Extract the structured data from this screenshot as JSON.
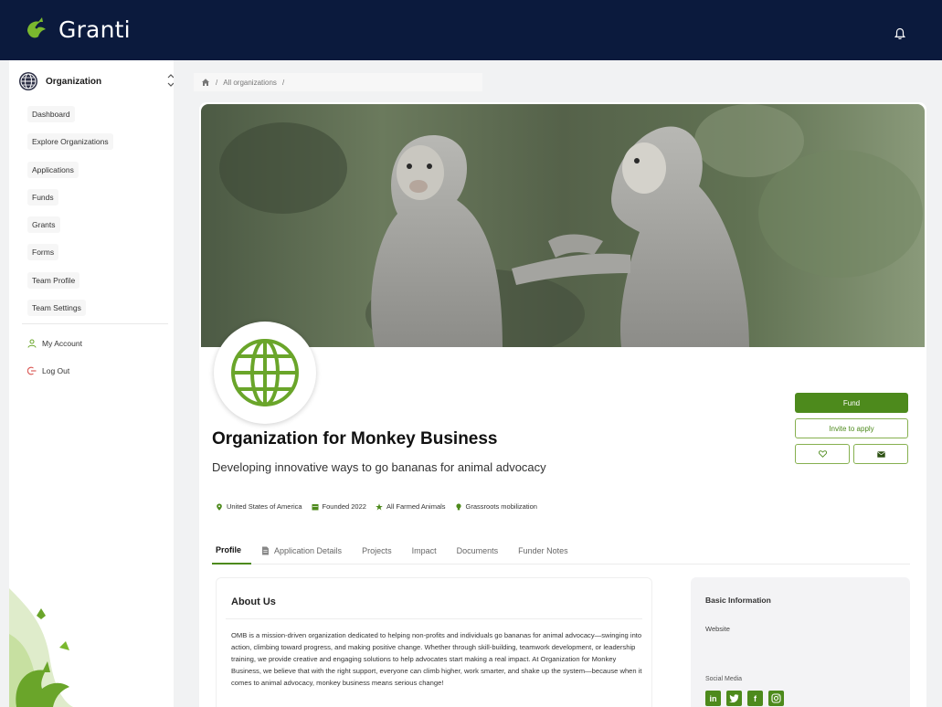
{
  "app": {
    "name": "Granti"
  },
  "sidebar": {
    "org_switch_label": "Organization",
    "nav": [
      "Dashboard",
      "Explore Organizations",
      "Applications",
      "Funds",
      "Grants",
      "Forms",
      "Team Profile",
      "Team Settings"
    ],
    "account": {
      "my_account": "My Account",
      "log_out": "Log Out"
    }
  },
  "breadcrumb": {
    "parts": [
      "All organizations"
    ],
    "separator": "/"
  },
  "org": {
    "name": "Organization for Monkey Business",
    "tagline": "Developing innovative ways to go bananas for animal advocacy",
    "meta": {
      "location": "United States of America",
      "founded": "Founded 2022",
      "focus": "All Farmed Animals",
      "approach": "Grassroots mobilization"
    }
  },
  "actions": {
    "fund": "Fund",
    "invite": "Invite to apply"
  },
  "tabs": [
    "Profile",
    "Application Details",
    "Projects",
    "Impact",
    "Documents",
    "Funder Notes"
  ],
  "about": {
    "title": "About Us",
    "body": "OMB is a mission-driven organization dedicated to helping non-profits and individuals go bananas for animal advocacy—swinging into action, climbing toward progress, and making positive change. Whether through skill-building, teamwork development, or leadership training, we provide creative and engaging solutions to help advocates start making a real impact. At Organization for Monkey Business, we believe that with the right support, everyone can climb higher, work smarter, and shake up the system—because when it comes to animal advocacy, monkey business means serious change!"
  },
  "basic_info": {
    "title": "Basic Information",
    "website_label": "Website",
    "social_label": "Social Media",
    "social_icons": [
      "linkedin-icon",
      "twitter-icon",
      "facebook-icon",
      "instagram-icon"
    ]
  },
  "colors": {
    "topbar": "#0b1a3d",
    "accent": "#4d8a1c",
    "accent_light": "#86b04f"
  }
}
